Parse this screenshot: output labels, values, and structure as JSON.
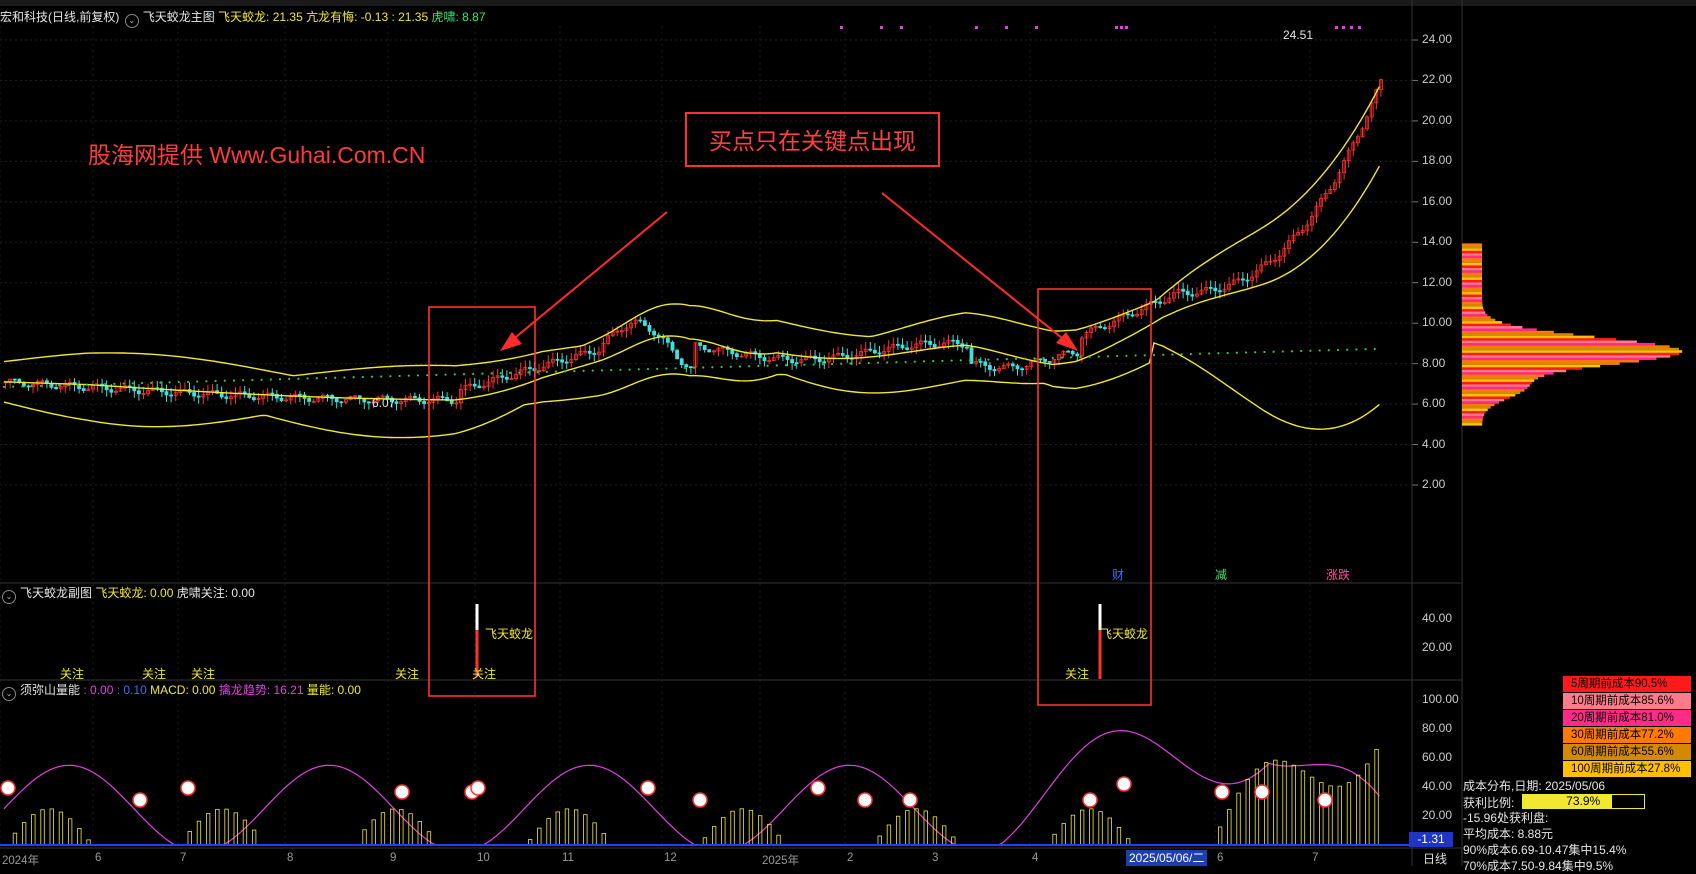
{
  "window": {
    "stock_name": "宏和科技",
    "period_mode": "(日线,前复权)",
    "main_indicator": "飞天蛟龙主图"
  },
  "main_values": {
    "feitian_label": "飞天蛟龙: 21.35",
    "kanglong_label": "亢龙有悔: -0.13 : 21.35",
    "huxiao_label": "虎啸: 8.87"
  },
  "watermark": "股海网提供 Www.Guhai.Com.CN",
  "annotation": "买点只在关键点出现",
  "price_axis": [
    "24.00",
    "22.00",
    "20.00",
    "18.00",
    "16.00",
    "14.00",
    "12.00",
    "10.00",
    "8.00",
    "6.00",
    "4.00",
    "2.00"
  ],
  "price_marks": {
    "high": "24.51",
    "low": "6.07"
  },
  "event_tags": {
    "cai": "财",
    "jian": "减",
    "zhangdie": "涨跌"
  },
  "sub1": {
    "title": "飞天蛟龙副图",
    "value1": "飞天蛟龙: 0.00",
    "value2": "虎啸关注: 0.00",
    "axis": [
      "40.00",
      "20.00"
    ],
    "signal_label": "飞天蛟龙",
    "focus_label": "关注"
  },
  "sub2": {
    "title": "须弥山量能",
    "v1": ": 0.00",
    "v2": ": 0.10",
    "macd": "MACD: 0.00",
    "trend": "擒龙趋势: 16.21",
    "vol": "量能: 0.00",
    "axis": [
      "100.00",
      "80.00",
      "60.00",
      "40.00",
      "20.00"
    ],
    "neg_value": "-1.31"
  },
  "date_axis": {
    "labels": [
      "2024年",
      "6",
      "7",
      "8",
      "9",
      "10",
      "11",
      "12",
      "2025年",
      "2",
      "3",
      "4",
      "6",
      "7"
    ],
    "selected_date": "2025/05/06/二",
    "period": "日线"
  },
  "cost_legend": [
    {
      "label": "5周期前成本90.5%",
      "color": "#ff1a1a"
    },
    {
      "label": "10周期前成本85.6%",
      "color": "#ff7a8a"
    },
    {
      "label": "20周期前成本81.0%",
      "color": "#ff2a8a"
    },
    {
      "label": "30周期前成本77.2%",
      "color": "#ff7a00"
    },
    {
      "label": "60周期前成本55.6%",
      "color": "#d48a00"
    },
    {
      "label": "100周期前成本27.8%",
      "color": "#ffc000"
    }
  ],
  "cost_info": {
    "date_line": "成本分布,日期: 2025/05/06",
    "profit_label": "获利比例:",
    "profit_value": "73.9%",
    "profit_fraction": 0.739,
    "profit_point": "-15.96处获利盘:",
    "avg_cost": "平均成本: 8.88元",
    "line90": "90%成本6.69-10.47集中15.4%",
    "line70": "70%成本7.50-9.84集中9.5%"
  },
  "colors": {
    "background": "#000000",
    "boll_line": "#f2e830",
    "ma_dots": "#2ecc40",
    "up_candle": "#ff3030",
    "down_candle": "#3ee0e0",
    "accent_red": "#ff3030",
    "magenta": "#e040e0"
  }
}
